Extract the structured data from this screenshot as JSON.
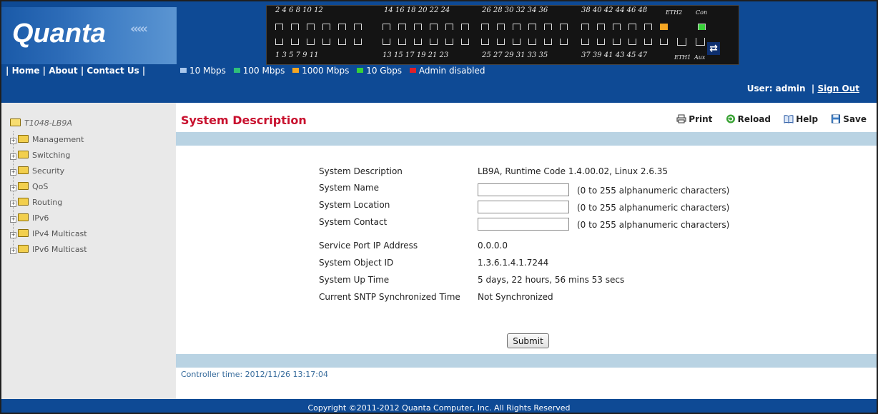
{
  "brand": {
    "logo": "Quanta"
  },
  "switch_panel": {
    "top_numbers": [
      "2 4 6 8 10 12",
      "14 16 18 20 22 24",
      "26 28 30 32 34 36",
      "38 40 42 44 46 48"
    ],
    "bottom_numbers": [
      "1 3 5 7 9 11",
      "13 15 17 19 21 23",
      "25 27 29 31 33 35",
      "37 39 41 43 45 47"
    ],
    "eth2": "ETH2",
    "con": "Con",
    "eth1": "ETH1",
    "aux": "Aux",
    "icon": "swap-arrows-icon"
  },
  "topnav": {
    "home": "Home",
    "about": "About",
    "contact": "Contact Us"
  },
  "legend": [
    {
      "label": "10 Mbps",
      "color": "#a9c7ec"
    },
    {
      "label": "100 Mbps",
      "color": "#2fbf7a"
    },
    {
      "label": "1000 Mbps",
      "color": "#f5a623"
    },
    {
      "label": "10 Gbps",
      "color": "#38d138"
    },
    {
      "label": "Admin disabled",
      "color": "#e0202a"
    }
  ],
  "user": {
    "label": "User: admin",
    "sign_out": "Sign Out"
  },
  "sidebar": {
    "root": "T1048-LB9A",
    "items": [
      "Management",
      "Switching",
      "Security",
      "QoS",
      "Routing",
      "IPv6",
      "IPv4 Multicast",
      "IPv6 Multicast"
    ]
  },
  "page": {
    "title": "System Description",
    "toolbar": {
      "print": "Print",
      "reload": "Reload",
      "help": "Help",
      "save": "Save"
    },
    "fields": {
      "description": {
        "label": "System Description",
        "value": "LB9A, Runtime Code 1.4.00.02, Linux 2.6.35"
      },
      "name": {
        "label": "System Name",
        "value": "",
        "hint": "(0 to 255 alphanumeric characters)"
      },
      "location": {
        "label": "System Location",
        "value": "",
        "hint": "(0 to 255 alphanumeric characters)"
      },
      "contact": {
        "label": "System Contact",
        "value": "",
        "hint": "(0 to 255 alphanumeric characters)"
      },
      "service_ip": {
        "label": "Service Port IP Address",
        "value": "0.0.0.0"
      },
      "object_id": {
        "label": "System Object ID",
        "value": "1.3.6.1.4.1.7244"
      },
      "uptime": {
        "label": "System Up Time",
        "value": "5 days, 22 hours, 56 mins 53 secs"
      },
      "sntp": {
        "label": "Current SNTP Synchronized Time",
        "value": "Not Synchronized"
      }
    },
    "submit": "Submit",
    "controller_time": "Controller time: 2012/11/26 13:17:04"
  },
  "footer": {
    "copyright": "Copyright ©2011-2012 Quanta Computer, Inc.   All Rights Reserved"
  },
  "colors": {
    "header_bg": "#0e4a95",
    "title_red": "#c8102e",
    "bar_blue": "#b9d3e3"
  }
}
